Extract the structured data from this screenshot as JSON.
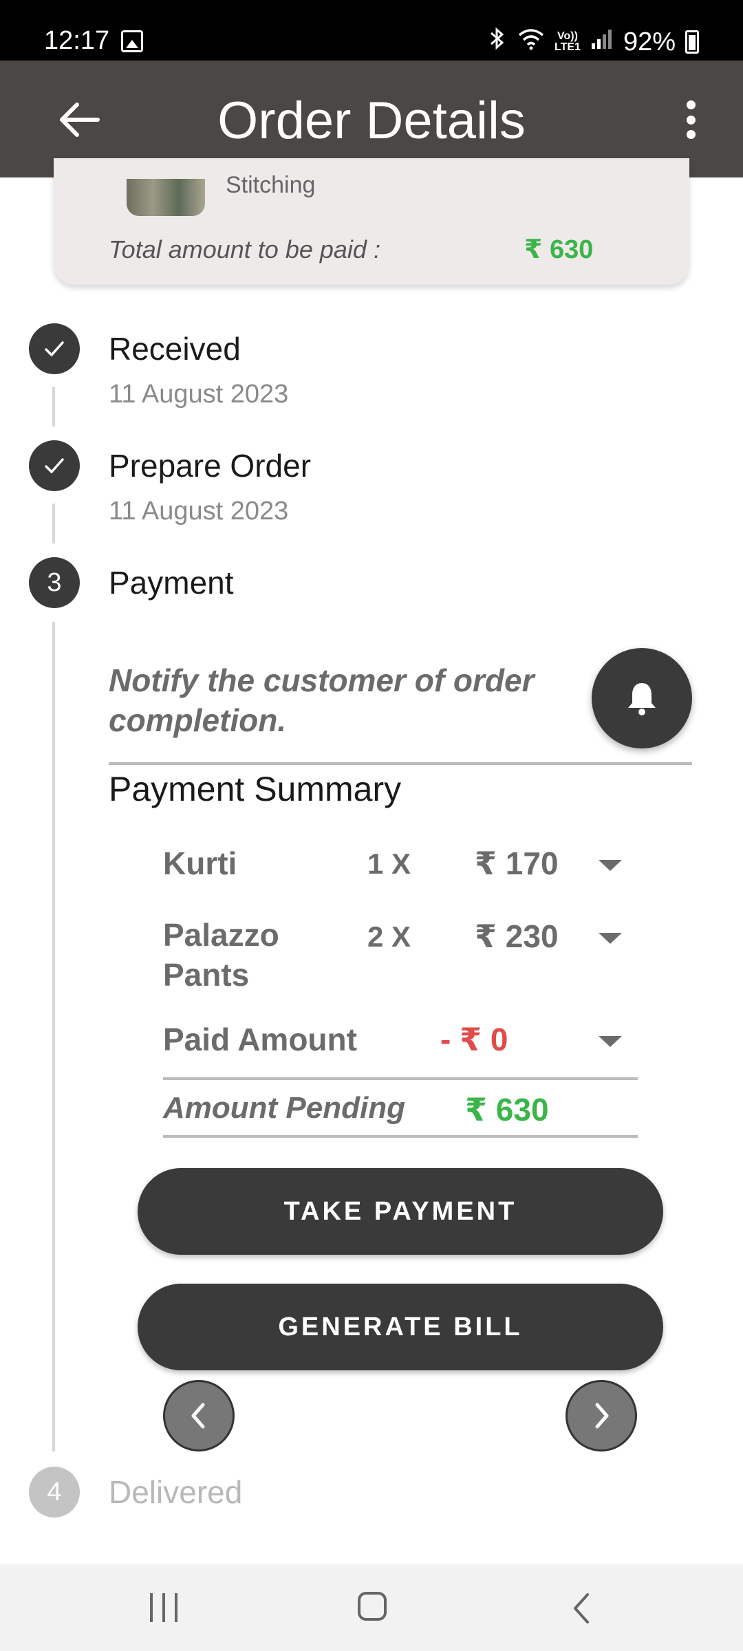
{
  "status_bar": {
    "time": "12:17",
    "volte": "Vo))\nLTE1",
    "battery": "92%"
  },
  "app_bar": {
    "title": "Order Details",
    "back_icon": "arrow-left-icon",
    "menu_icon": "more-vert-icon"
  },
  "order_card": {
    "service": "Stitching",
    "total_label": "Total amount to be paid :",
    "total_value": "₹ 630"
  },
  "steps": [
    {
      "number": "1",
      "title": "Received",
      "date": "11 August 2023",
      "status": "completed"
    },
    {
      "number": "2",
      "title": "Prepare Order",
      "date": "11 August 2023",
      "status": "completed"
    },
    {
      "number": "3",
      "title": "Payment",
      "date": "",
      "status": "active"
    },
    {
      "number": "4",
      "title": "Delivered",
      "date": "",
      "status": "pending"
    }
  ],
  "payment_step": {
    "notify_text": "Notify the customer of order completion.",
    "summary_title": "Payment Summary",
    "items": [
      {
        "name": "Kurti",
        "qty": "1 X",
        "price": "₹ 170"
      },
      {
        "name": "Palazzo Pants",
        "qty": "2 X",
        "price": "₹ 230"
      }
    ],
    "paid_label": "Paid Amount",
    "paid_value": "- ₹ 0",
    "pending_label": "Amount Pending",
    "pending_value": "₹ 630",
    "take_payment_label": "TAKE PAYMENT",
    "generate_bill_label": "GENERATE BILL"
  },
  "colors": {
    "app_bar": "#4a4745",
    "dark": "#3a3a3a",
    "green": "#3bb54a",
    "red": "#e14b4b"
  }
}
